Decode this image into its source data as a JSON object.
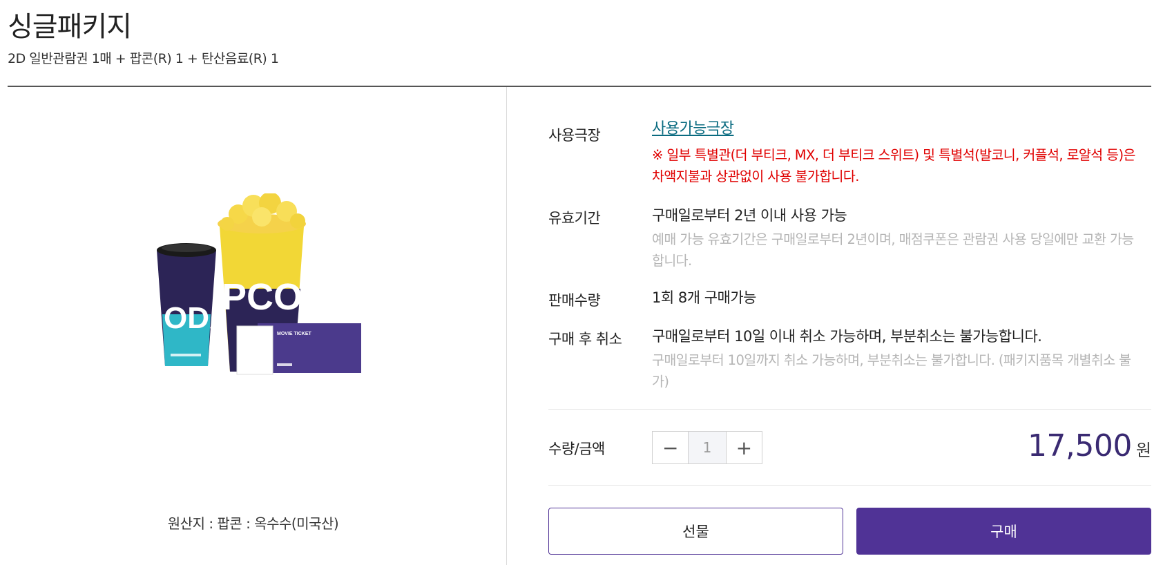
{
  "product": {
    "title": "싱글패키지",
    "subtitle": "2D 일반관람권 1매 + 팝콘(R) 1 + 탄산음료(R) 1",
    "origin": "원산지 : 팝콘 : 옥수수(미국산)",
    "image_cup_text": "ODA",
    "image_popcorn_text": "PCO",
    "image_ticket_text": "MOVIE TICKET"
  },
  "info": {
    "theater_label": "사용극장",
    "theater_link": "사용가능극장",
    "theater_warning": "※ 일부 특별관(더 부티크, MX, 더 부티크 스위트) 및 특별석(발코니, 커플석, 로얄석 등)은 차액지불과 상관없이 사용 불가합니다.",
    "validity_label": "유효기간",
    "validity_value": "구매일로부터 2년 이내 사용 가능",
    "validity_note": "예매 가능 유효기간은 구매일로부터 2년이며, 매점쿠폰은 관람권 사용 당일에만 교환 가능합니다.",
    "sales_label": "판매수량",
    "sales_value": "1회 8개 구매가능",
    "cancel_label": "구매 후 취소",
    "cancel_value": "구매일로부터 10일 이내 취소 가능하며, 부분취소는 불가능합니다.",
    "cancel_note": "구매일로부터 10일까지 취소 가능하며, 부분취소는 불가합니다. (패키지품목 개별취소 불가)"
  },
  "purchase": {
    "qty_label": "수량/금액",
    "qty_value": "1",
    "minus_symbol": "−",
    "plus_symbol": "+",
    "price": "17,500",
    "currency": "원",
    "gift_button": "선물",
    "buy_button": "구매"
  },
  "colors": {
    "brand": "#503396",
    "price": "#3a2a72",
    "link": "#0a6b80",
    "warning": "#e00000",
    "note": "#b5b5b5"
  }
}
